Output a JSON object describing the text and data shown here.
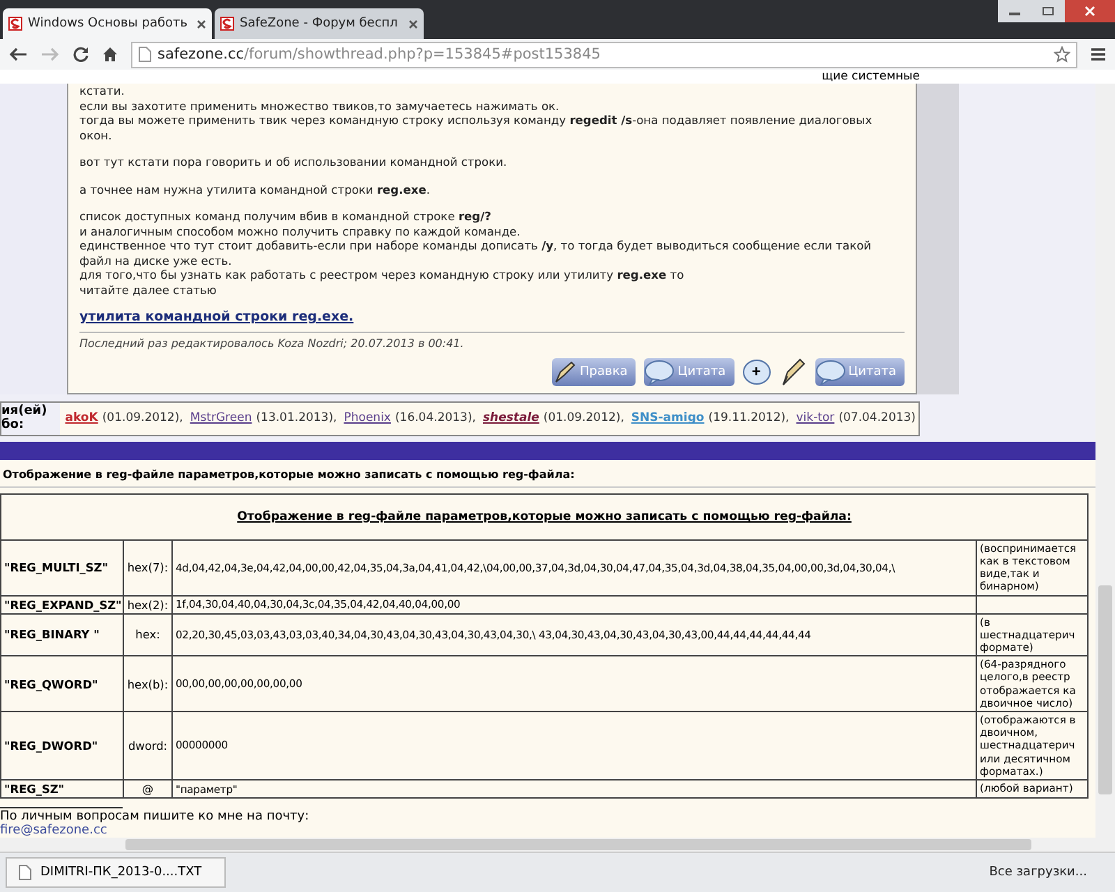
{
  "tabs": [
    {
      "label": "Windows Основы работь",
      "selected": true
    },
    {
      "label": "SafeZone - Форум беспл",
      "selected": false
    }
  ],
  "address_bar": {
    "host": "safezone.cc",
    "path": "/forum/showthread.php?p=153845#post153845"
  },
  "bookmarks_fragment": "щие системные",
  "post": {
    "paragraphs": [
      "кстати.\nесли вы захотите применить множество твиков,то замучаетесь нажимать ок.\nтогда вы можете применить твик через командную строку используя команду **regedit /s**-она подавляет появление диалоговых окон.",
      "вот тут кстати пора говорить и об использовании командной строки.",
      "а точнее нам нужна утилита командной строки **reg.exe**.",
      "список доступных команд получим вбив в командной строке **reg/?**\nи аналогичным способом можно получить справку по каждой команде.\nединственное что тут стоит добавить-если при наборе команды дописать **/y**, то тогда будет выводиться сообщение если такой файл на диске уже есть.\nдля того,что бы узнать как работать с реестром через командную строку или утилиту **reg.exe** то\nчитайте далее статью"
    ],
    "link": "утилита командной строки reg.exe.",
    "edited": "Последний раз редактировалось Koza Nozdri; 20.07.2013 в 00:41.",
    "buttons": [
      {
        "kind": "edit",
        "label": "Правка"
      },
      {
        "kind": "quote",
        "label": "Цитата"
      },
      {
        "kind": "plus",
        "label": "+"
      },
      {
        "kind": "pen"
      },
      {
        "kind": "quote",
        "label": "Цитата"
      }
    ]
  },
  "thanks": {
    "label": [
      "ия(ей)",
      "бо:"
    ],
    "users": [
      {
        "name": "akoK",
        "date": "(01.09.2012),",
        "color": "#c0282d"
      },
      {
        "name": "MstrGreen",
        "date": "(13.01.2013),",
        "color": "#5a3e8c"
      },
      {
        "name": "Phoenix",
        "date": "(16.04.2013),",
        "color": "#5a3e8c"
      },
      {
        "name": "shestale",
        "date": "(01.09.2012),",
        "color": "#7a1a3a"
      },
      {
        "name": "SNS-amigo",
        "date": "(19.11.2012),",
        "color": "#3f8fc8"
      },
      {
        "name": "vik-tor",
        "date": "(07.04.2013)",
        "color": "#5a3e8c"
      }
    ]
  },
  "section_heading": "Отображение в reg-файле параметров,которые можно записать с помощью reg-файла:",
  "table": {
    "caption": "Отображение в reg-файле параметров,которые можно записать с помощью reg-файла:",
    "rows": [
      {
        "name": "\"REG_MULTI_SZ\"",
        "type": "hex(7):",
        "data": "4d,04,42,04,3e,04,42,04,00,00,42,04,35,04,3a,04,41,04,42,\\04,00,00,37,04,3d,04,30,04,47,04,35,04,3d,04,38,04,35,04,00,00,3d,04,30,04,\\",
        "note": [
          "(воспринимается",
          "как в текстовом",
          "виде,так и",
          "бинарном)"
        ]
      },
      {
        "name": "\"REG_EXPAND_SZ\"",
        "type": "hex(2):",
        "data": "1f,04,30,04,40,04,30,04,3c,04,35,04,42,04,40,04,00,00",
        "note": []
      },
      {
        "name": "\"REG_BINARY \"",
        "type": "hex:",
        "data": "02,20,30,45,03,03,43,03,03,40,34,04,30,43,04,30,43,04,30,43,04,30,\\ 43,04,30,43,04,30,43,04,30,43,00,44,44,44,44,44,44",
        "note": [
          "(в",
          "шестнадцатерич",
          "формате)"
        ]
      },
      {
        "name": "\"REG_QWORD\"",
        "type": "hex(b):",
        "data": "00,00,00,00,00,00,00,00",
        "note": [
          "(64-разрядного",
          "целого,в реестр",
          "отображается ка",
          "двоичное число)"
        ]
      },
      {
        "name": "\"REG_DWORD\"",
        "type": "dword:",
        "data": "00000000",
        "note": [
          "(отображаются в",
          "двоичном,",
          "шестнадцатерич",
          "или десятичном",
          "форматах.)"
        ]
      },
      {
        "name": "\"REG_SZ\"",
        "type": "@",
        "data": "\"параметр\"",
        "note": [
          "(любой вариант)"
        ]
      }
    ]
  },
  "footer": {
    "text": "По личным вопросам пишите ко мне на почту:",
    "email": "fire@safezone.cc"
  },
  "downloads": {
    "file": "DIMITRI-ПК_2013-0....TXT",
    "all": "Все загрузки..."
  }
}
